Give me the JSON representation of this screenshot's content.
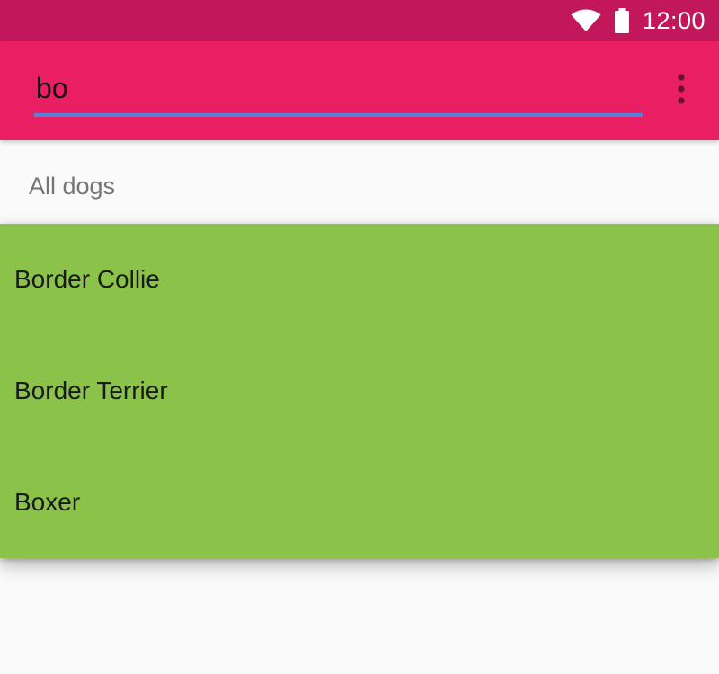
{
  "status_bar": {
    "time": "12:00",
    "background_color": "#c2185b",
    "icons": [
      "wifi-icon",
      "battery-icon"
    ]
  },
  "toolbar": {
    "background_color": "#e91e63",
    "search": {
      "value": "bo",
      "underline_color": "#5c7fd6"
    },
    "overflow_icon": "more-vert-icon"
  },
  "main": {
    "section_label": "All dogs"
  },
  "suggestions": {
    "background_color": "#8bc34a",
    "items": [
      {
        "label": "Border Collie"
      },
      {
        "label": "Border Terrier"
      },
      {
        "label": "Boxer"
      }
    ]
  }
}
